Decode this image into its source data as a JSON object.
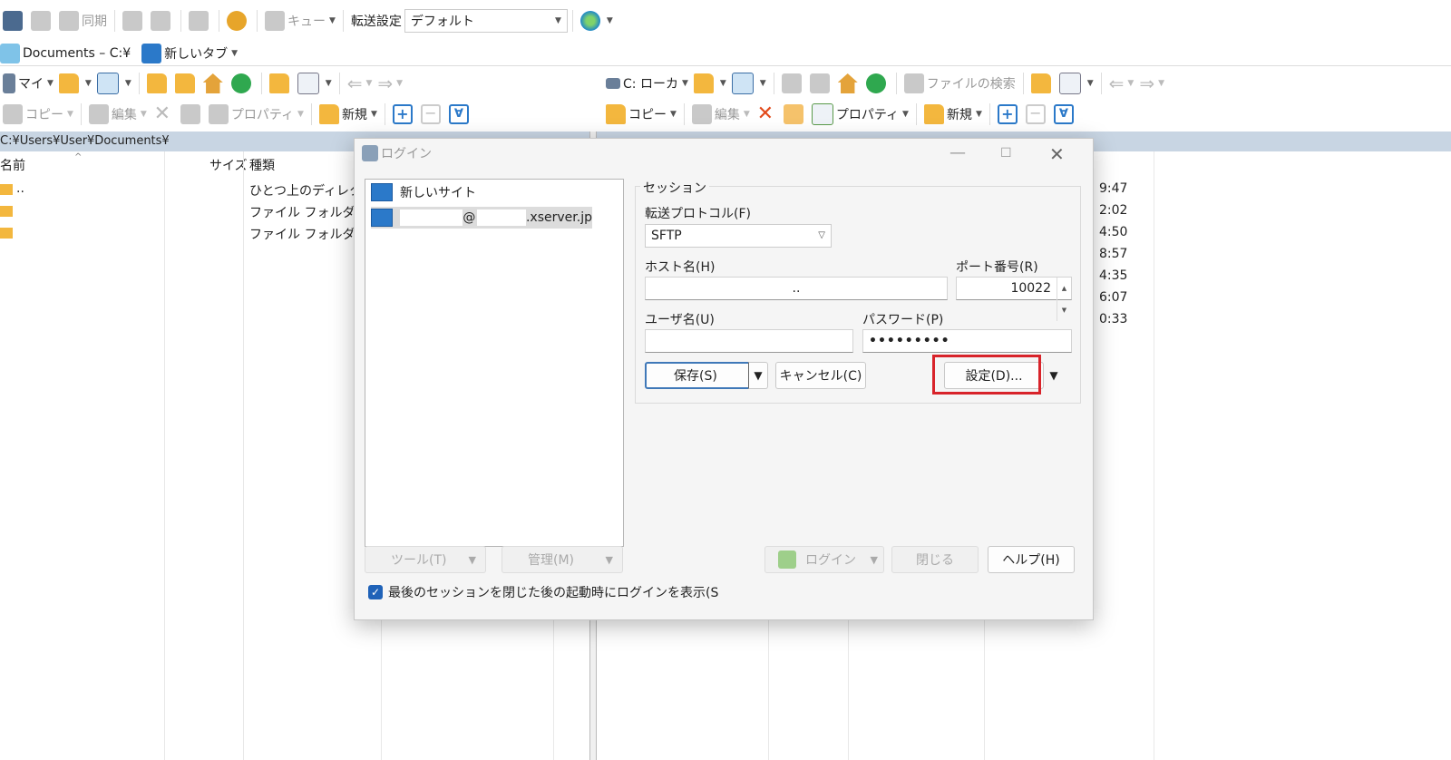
{
  "toolbar_top": {
    "sync_label": "同期",
    "queue_label": "キュー",
    "transfer_settings_label": "転送設定",
    "transfer_settings_value": "デフォルト"
  },
  "tabs": [
    {
      "label": "Documents – C:¥"
    },
    {
      "label": "新しいタブ"
    }
  ],
  "left_panel": {
    "drive_label": "マイ",
    "copy_label": "コピー",
    "edit_label": "編集",
    "properties_label": "プロパティ",
    "new_label": "新規",
    "path": "C:¥Users¥User¥Documents¥",
    "columns": {
      "name": "名前",
      "size": "サイズ",
      "type": "種類"
    },
    "rows": [
      {
        "name": "..",
        "type": "ひとつ上のディレクト"
      },
      {
        "name": "",
        "type": "ファイル フォルダー"
      },
      {
        "name": "",
        "type": "ファイル フォルダー"
      }
    ]
  },
  "right_panel": {
    "drive_label": "C: ローカ",
    "find_files_label": "ファイルの検索",
    "copy_label": "コピー",
    "edit_label": "編集",
    "properties_label": "プロパティ",
    "new_label": "新規",
    "times": [
      "9:47",
      "2:02",
      "4:50",
      "8:57",
      "4:35",
      "6:07",
      "0:33"
    ]
  },
  "login_dialog": {
    "title": "ログイン",
    "sites": [
      {
        "label": "新しいサイト"
      },
      {
        "label_at": "@",
        "label_domain": ".xserver.jp"
      }
    ],
    "session_label": "セッション",
    "protocol_label": "転送プロトコル(F)",
    "protocol_value": "SFTP",
    "host_label": "ホスト名(H)",
    "host_value": "..",
    "port_label": "ポート番号(R)",
    "port_value": "10022",
    "user_label": "ユーザ名(U)",
    "user_value": "",
    "password_label": "パスワード(P)",
    "password_value": "•••••••••",
    "save_label": "保存(S)",
    "cancel_label": "キャンセル(C)",
    "advanced_label": "設定(D)...",
    "tools_label": "ツール(T)",
    "manage_label": "管理(M)",
    "login_label": "ログイン",
    "close_label": "閉じる",
    "help_label": "ヘルプ(H)",
    "show_login_checkbox_label": "最後のセッションを閉じた後の起動時にログインを表示(S"
  }
}
